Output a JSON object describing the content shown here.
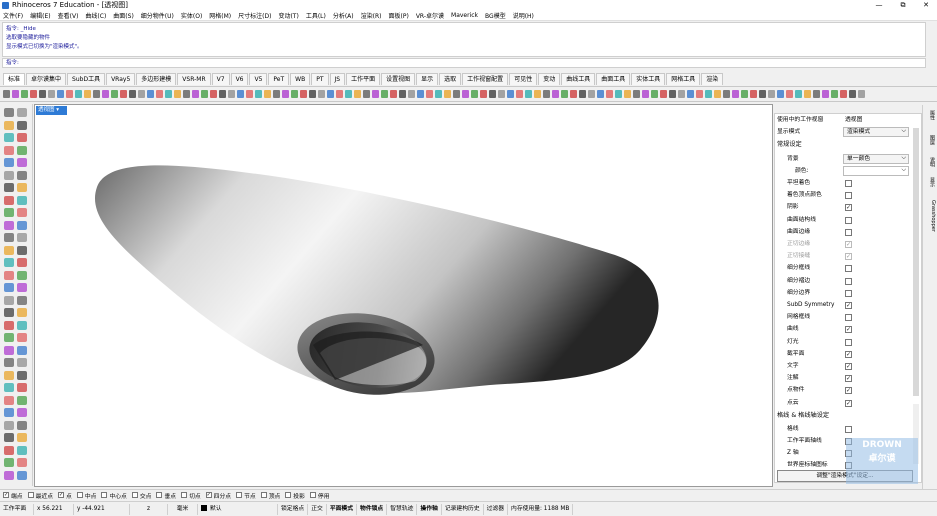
{
  "window": {
    "title": "Rhinoceros 7 Education - [透视图]",
    "minimize": "—",
    "restore": "⧉",
    "close": "✕"
  },
  "menu": [
    "文件(F)",
    "编辑(E)",
    "查看(V)",
    "曲线(C)",
    "曲面(S)",
    "细分物件(U)",
    "实体(O)",
    "网格(M)",
    "尺寸标注(D)",
    "变动(T)",
    "工具(L)",
    "分析(A)",
    "渲染(R)",
    "面板(P)",
    "VR-卓尔谟",
    "Maverick",
    "BG模型",
    "说明(H)"
  ],
  "command": {
    "history": [
      "指令: _Hide",
      "选取要隐藏的物件",
      "显示模式已切换为\"渲染模式\"。"
    ],
    "prompt": "指令:"
  },
  "tabs": [
    "标准",
    "卓尔谟集中",
    "SubD工具",
    "VRay5",
    "多边形建模",
    "VSR-MR",
    "V7",
    "V6",
    "V5",
    "PeT",
    "WB",
    "PT",
    "JS",
    "工作平面",
    "设置视图",
    "显示",
    "选取",
    "工作视窗配置",
    "可见性",
    "变动",
    "曲线工具",
    "曲面工具",
    "实体工具",
    "网格工具",
    "渲染"
  ],
  "viewport": {
    "label": "透视图"
  },
  "panel": {
    "header_label": "使用中的工作视窗",
    "header_value": "透视图",
    "display_mode_label": "显示模式",
    "display_mode_value": "渲染模式",
    "section_general": "常规设定",
    "background_label": "背景",
    "background_value": "单一颜色",
    "color_label": "颜色:",
    "section_grid": "格线 & 格线轴设定",
    "apply_button": "调整\"渲染模式\"设定...",
    "rows": [
      {
        "label": "平坦着色",
        "checked": false,
        "disabled": false
      },
      {
        "label": "着色顶点颜色",
        "checked": false,
        "disabled": false
      },
      {
        "label": "阴影",
        "checked": true,
        "disabled": false
      },
      {
        "label": "曲面结构线",
        "checked": false,
        "disabled": false
      },
      {
        "label": "曲面边缘",
        "checked": false,
        "disabled": false
      },
      {
        "label": "正切边缘",
        "checked": true,
        "disabled": true
      },
      {
        "label": "正切接缝",
        "checked": true,
        "disabled": true
      },
      {
        "label": "细分框线",
        "checked": false,
        "disabled": false
      },
      {
        "label": "细分褶边",
        "checked": false,
        "disabled": false
      },
      {
        "label": "细分边界",
        "checked": false,
        "disabled": false
      },
      {
        "label": "SubD Symmetry",
        "checked": true,
        "disabled": false
      },
      {
        "label": "网格框线",
        "checked": false,
        "disabled": false
      },
      {
        "label": "曲线",
        "checked": true,
        "disabled": false
      },
      {
        "label": "灯光",
        "checked": false,
        "disabled": false
      },
      {
        "label": "截平面",
        "checked": true,
        "disabled": false
      },
      {
        "label": "文字",
        "checked": true,
        "disabled": false
      },
      {
        "label": "注解",
        "checked": true,
        "disabled": false
      },
      {
        "label": "点物件",
        "checked": true,
        "disabled": false
      },
      {
        "label": "点云",
        "checked": true,
        "disabled": false
      }
    ],
    "grid_rows": [
      {
        "label": "格线",
        "checked": false
      },
      {
        "label": "工作平面轴线",
        "checked": false
      },
      {
        "label": "Z 轴",
        "checked": false
      },
      {
        "label": "世界座标轴图标",
        "checked": false
      }
    ]
  },
  "side_tabs": [
    "属性",
    "图层",
    "说明",
    "显示",
    "Grasshopper"
  ],
  "osnap": [
    {
      "label": "端点",
      "checked": true
    },
    {
      "label": "最近点",
      "checked": false
    },
    {
      "label": "点",
      "checked": true
    },
    {
      "label": "中点",
      "checked": false
    },
    {
      "label": "中心点",
      "checked": false
    },
    {
      "label": "交点",
      "checked": false
    },
    {
      "label": "垂点",
      "checked": false
    },
    {
      "label": "切点",
      "checked": false
    },
    {
      "label": "四分点",
      "checked": true
    },
    {
      "label": "节点",
      "checked": false
    },
    {
      "label": "顶点",
      "checked": false
    },
    {
      "label": "投影",
      "checked": false
    },
    {
      "label": "停用",
      "checked": false
    }
  ],
  "status": {
    "plane": "工作平面",
    "x": "x 56.221",
    "y": "y -44.921",
    "z": "z",
    "unit": "毫米",
    "layer": "默认",
    "items": [
      "锁定格点",
      "正交",
      "平面模式",
      "物件锁点",
      "智慧轨迹",
      "操作轴",
      "记录建构历史",
      "过滤器",
      "内存使用量: 1188 MB"
    ],
    "bold": [
      false,
      false,
      true,
      true,
      false,
      true,
      false,
      false,
      false
    ]
  },
  "watermark": [
    "DROWN",
    "卓尔谟"
  ],
  "colors": {
    "accent": "#2e7bd6",
    "text_blue": "#1a1a9a"
  }
}
